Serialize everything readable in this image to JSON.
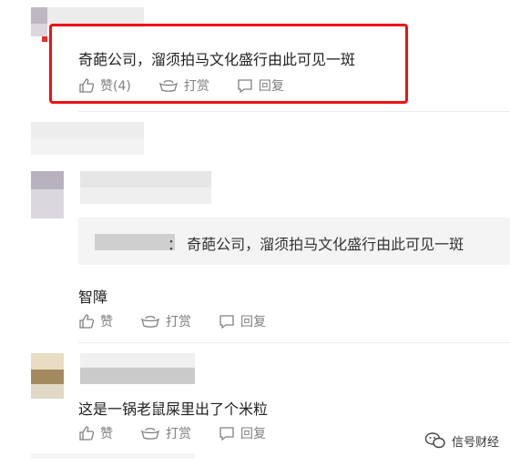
{
  "comments": [
    {
      "text": "奇葩公司，溜须拍马文化盛行由此可见一斑",
      "like_label": "赞(4)",
      "tip_label": "打赏",
      "reply_label": "回复"
    },
    {
      "quote_text": "：  奇葩公司，溜须拍马文化盛行由此可见一斑",
      "text": "智障",
      "like_label": "赞",
      "tip_label": "打赏",
      "reply_label": "回复"
    },
    {
      "text": "这是一锅老鼠屎里出了个米粒",
      "like_label": "赞",
      "tip_label": "打赏",
      "reply_label": "回复"
    }
  ],
  "watermark": {
    "label": "信号财经"
  },
  "colors": {
    "highlight": "#ee1111",
    "action_text": "#808080",
    "quote_bg": "#f4f4f4"
  }
}
